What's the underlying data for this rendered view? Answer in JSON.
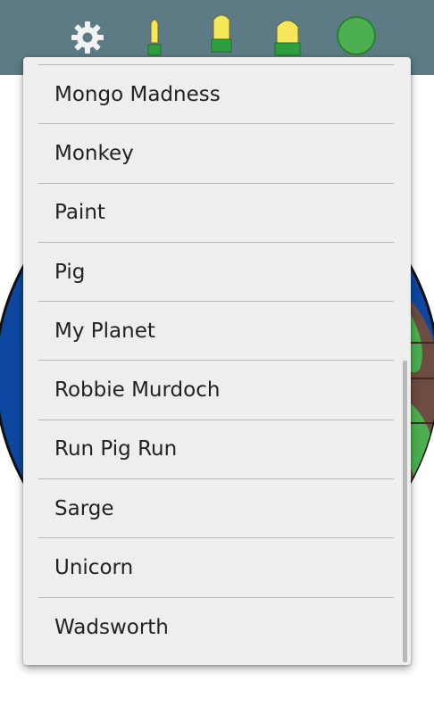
{
  "toolbar": {
    "background_color": "#5c7b85",
    "icons": [
      {
        "name": "gear-icon",
        "color": "#f2f2f2"
      },
      {
        "name": "thin-pen-icon",
        "color": "#f5e65a"
      },
      {
        "name": "medium-pen-icon",
        "color": "#f5e65a"
      },
      {
        "name": "thick-pen-icon",
        "color": "#f5e65a"
      },
      {
        "name": "color-swatch-icon",
        "color": "#4caf50"
      }
    ]
  },
  "dropdown": {
    "items": [
      {
        "label": "Mongo Madness"
      },
      {
        "label": "Monkey"
      },
      {
        "label": "Paint"
      },
      {
        "label": "Pig"
      },
      {
        "label": "My Planet"
      },
      {
        "label": "Robbie Murdoch"
      },
      {
        "label": "Run Pig Run"
      },
      {
        "label": "Sarge"
      },
      {
        "label": "Unicorn"
      },
      {
        "label": "Wadsworth"
      }
    ]
  },
  "colors": {
    "planet_ocean": "#0d47a1",
    "planet_land": "#4caf50",
    "planet_brown": "#6d4c41",
    "menu_background": "#eeeeee"
  }
}
